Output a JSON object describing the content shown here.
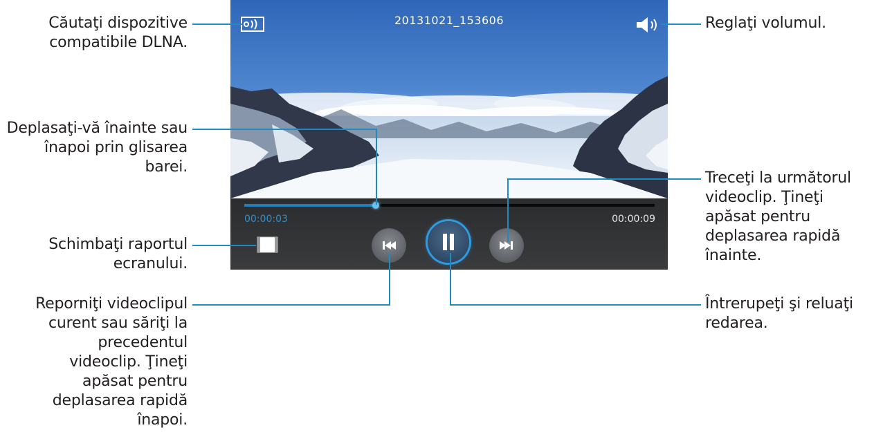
{
  "player": {
    "title": "20131021_153606",
    "elapsed": "00:00:03",
    "total": "00:00:09",
    "progress_fraction": 0.32,
    "accent_color": "#1e8bc3"
  },
  "callouts": {
    "dlna": [
      "Căutaţi dispozitive",
      "compatibile DLNA."
    ],
    "volume": [
      "Reglaţi volumul."
    ],
    "seek": [
      "Deplasaţi-vă înainte sau",
      "înapoi prin glisarea",
      "barei."
    ],
    "next": [
      "Treceţi la următorul",
      "videoclip. Ţineţi",
      "apăsat pentru",
      "deplasarea rapidă",
      "înainte."
    ],
    "ratio": [
      "Schimbaţi raportul",
      "ecranului."
    ],
    "pause": [
      "Întrerupeţi şi reluaţi",
      "redarea."
    ],
    "prev": [
      "Reporniţi videoclipul",
      "curent sau săriţi la",
      "precedentul",
      "videoclip. Ţineţi",
      "apăsat pentru",
      "deplasarea rapidă",
      "înapoi."
    ]
  },
  "icons": {
    "dlna": "dlna-icon",
    "volume": "speaker-icon",
    "ratio": "aspect-ratio-icon",
    "prev": "skip-previous-icon",
    "pause": "pause-icon",
    "next": "skip-next-icon"
  }
}
